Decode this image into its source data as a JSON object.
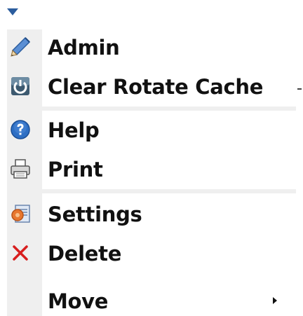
{
  "menu": {
    "items": [
      {
        "label": "Admin",
        "icon": "pencil-icon"
      },
      {
        "label": "Clear Rotate Cache",
        "icon": "rotate-icon"
      },
      {
        "label": "Help",
        "icon": "help-icon"
      },
      {
        "label": "Print",
        "icon": "printer-icon"
      },
      {
        "label": "Settings",
        "icon": "settings-icon"
      },
      {
        "label": "Delete",
        "icon": "delete-icon"
      },
      {
        "label": "Move",
        "icon": "",
        "has_submenu": true
      }
    ]
  },
  "colors": {
    "gutter": "#efefef",
    "accent_blue": "#2b5d9e",
    "delete_red": "#d81e1e",
    "text": "#111111"
  }
}
